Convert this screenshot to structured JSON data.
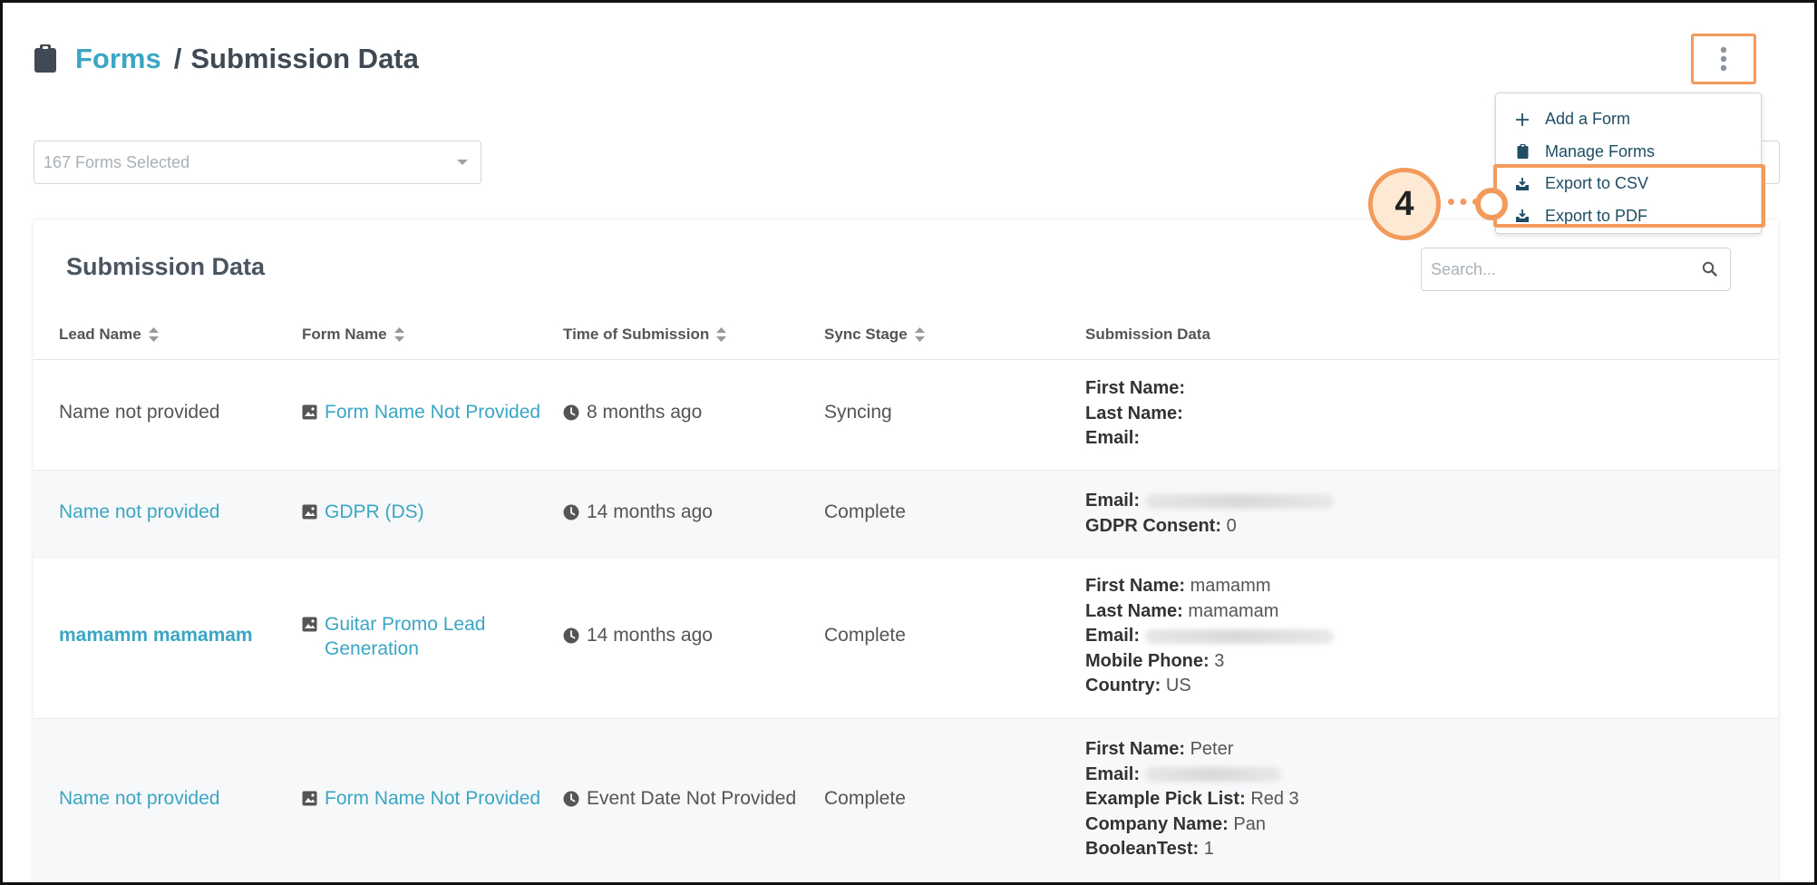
{
  "header": {
    "breadcrumb_link": "Forms",
    "breadcrumb_sep": "/",
    "breadcrumb_current": "Submission Data"
  },
  "menu": {
    "items": [
      {
        "label": "Add a Form",
        "icon": "plus-icon"
      },
      {
        "label": "Manage Forms",
        "icon": "clipboard-icon"
      },
      {
        "label": "Export to CSV",
        "icon": "download-tray-icon"
      },
      {
        "label": "Export to PDF",
        "icon": "download-tray-icon"
      }
    ]
  },
  "callout": {
    "number": "4"
  },
  "forms_select": {
    "value": "167 Forms Selected"
  },
  "card": {
    "title": "Submission Data",
    "search_placeholder": "Search..."
  },
  "table": {
    "columns": [
      "Lead Name",
      "Form Name",
      "Time of Submission",
      "Sync Stage",
      "Submission Data"
    ],
    "rows": [
      {
        "lead": "Name not provided",
        "form": "Form Name Not Provided",
        "time": "8 months ago",
        "stage": "Syncing",
        "data": [
          {
            "label": "First Name:",
            "value": ""
          },
          {
            "label": "Last Name:",
            "value": ""
          },
          {
            "label": "Email:",
            "value": ""
          }
        ]
      },
      {
        "lead": "Name not provided",
        "form": "GDPR (DS)",
        "time": "14 months ago",
        "stage": "Complete",
        "data": [
          {
            "label": "Email:",
            "value": ""
          },
          {
            "label": "GDPR Consent:",
            "value": "0"
          }
        ]
      },
      {
        "lead": "mamamm mamamam",
        "form": "Guitar Promo Lead Generation",
        "time": "14 months ago",
        "stage": "Complete",
        "data": [
          {
            "label": "First Name:",
            "value": "mamamm"
          },
          {
            "label": "Last Name:",
            "value": "mamamam"
          },
          {
            "label": "Email:",
            "value": ""
          },
          {
            "label": "Mobile Phone:",
            "value": "3"
          },
          {
            "label": "Country:",
            "value": "US"
          }
        ]
      },
      {
        "lead": "Name not provided",
        "form": "Form Name Not Provided",
        "time": "Event Date Not Provided",
        "stage": "Complete",
        "data": [
          {
            "label": "First Name:",
            "value": "Peter"
          },
          {
            "label": "Email:",
            "value": ""
          },
          {
            "label": "Example Pick List:",
            "value": "Red 3"
          },
          {
            "label": "Company Name:",
            "value": "Pan"
          },
          {
            "label": "BooleanTest:",
            "value": "1"
          }
        ]
      }
    ]
  },
  "colors": {
    "link": "#3aa6c3",
    "highlight": "#f39a5d",
    "heading": "#3f4a54",
    "row_alt": "#f7f8f9"
  }
}
